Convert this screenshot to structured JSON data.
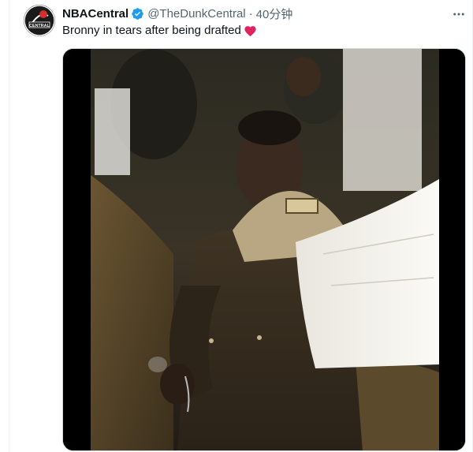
{
  "tweet": {
    "display_name": "NBACentral",
    "handle": "@TheDunkCentral",
    "separator": "·",
    "time": "40分钟",
    "text": "Bronny in tears after being drafted",
    "emoji": "red-heart",
    "verified_color": "#1d9bf0",
    "heart_color": "#e0245e"
  },
  "icons": {
    "verified": "verified-badge-icon",
    "more": "more-horizontal-icon",
    "avatar": "nba-central-logo"
  },
  "avatar_logo_text": "CENTRAL"
}
